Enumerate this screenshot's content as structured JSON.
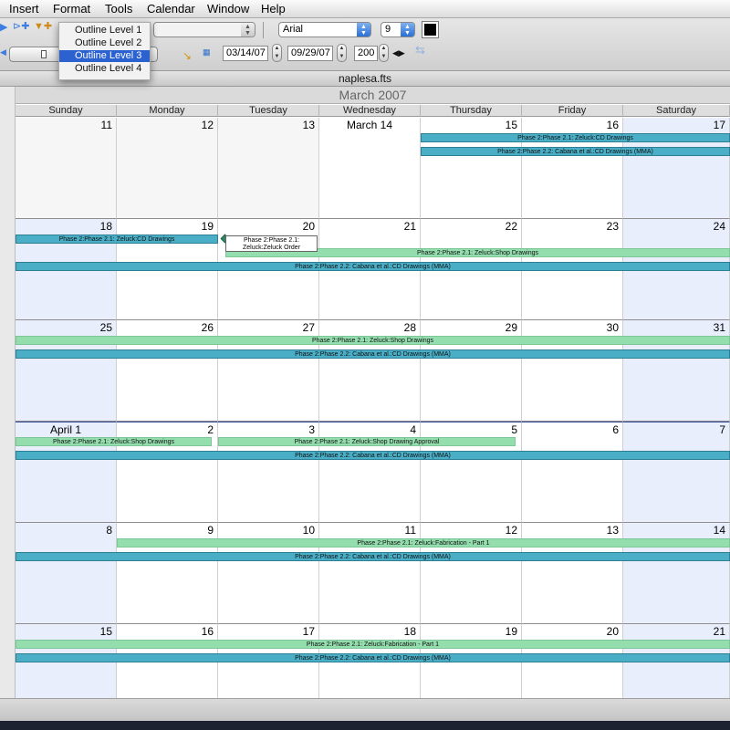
{
  "menubar": {
    "items": [
      "Insert",
      "Format",
      "Tools",
      "Calendar",
      "Window",
      "Help"
    ]
  },
  "toolbar": {
    "font": "Arial",
    "font_size": "9",
    "start_date": "03/14/07",
    "end_date": "09/29/07",
    "zoom": "200",
    "nav_arrows": "◀▶",
    "color_swatch": "#000000"
  },
  "outline_menu": {
    "items": [
      "Outline Level 1",
      "Outline Level 2",
      "Outline Level 3",
      "Outline Level 4"
    ],
    "selected_index": 2
  },
  "window": {
    "title": "naplesa.fts"
  },
  "calendar": {
    "month_title": "March 2007",
    "weekdays": [
      "Sunday",
      "Monday",
      "Tuesday",
      "Wednesday",
      "Thursday",
      "Friday",
      "Saturday"
    ],
    "weeks": [
      [
        "11",
        "12",
        "13",
        "March 14",
        "15",
        "16",
        "17"
      ],
      [
        "18",
        "19",
        "20",
        "21",
        "22",
        "23",
        "24"
      ],
      [
        "25",
        "26",
        "27",
        "28",
        "29",
        "30",
        "31"
      ],
      [
        "April 1",
        "2",
        "3",
        "4",
        "5",
        "6",
        "7"
      ],
      [
        "8",
        "9",
        "10",
        "11",
        "12",
        "13",
        "14"
      ],
      [
        "15",
        "16",
        "17",
        "18",
        "19",
        "20",
        "21"
      ]
    ],
    "tooltip": "Phase 2:Phase 2.1: Zeluck:Zeluck Order",
    "tasks": [
      {
        "week": 0,
        "start": 4,
        "end": 6,
        "lane": 0,
        "color": "teal",
        "label": "Phase 2:Phase 2.1: Zeluck:CD Drawings"
      },
      {
        "week": 0,
        "start": 4,
        "end": 6,
        "lane": 1,
        "color": "teal",
        "label": "Phase 2:Phase 2.2: Cabana et al.:CD Drawings (MMA)"
      },
      {
        "week": 1,
        "start": 0,
        "end": 1,
        "lane": 0,
        "color": "teal",
        "label": "Phase 2:Phase 2.1: Zeluck:CD Drawings"
      },
      {
        "week": 1,
        "start": 2,
        "end": 6,
        "lane": 1,
        "color": "green",
        "label": "Phase 2:Phase 2.1: Zeluck:Shop Drawings"
      },
      {
        "week": 1,
        "start": 0,
        "end": 6,
        "lane": 2,
        "color": "teal",
        "label": "Phase 2:Phase 2.2: Cabana et al.:CD Drawings (MMA)"
      },
      {
        "week": 2,
        "start": 0,
        "end": 6,
        "lane": 0,
        "color": "green",
        "label": "Phase 2:Phase 2.1: Zeluck:Shop Drawings"
      },
      {
        "week": 2,
        "start": 0,
        "end": 6,
        "lane": 1,
        "color": "teal",
        "label": "Phase 2:Phase 2.2: Cabana et al.:CD Drawings (MMA)"
      },
      {
        "week": 3,
        "start": 0,
        "end": 1,
        "lane": 0,
        "color": "green",
        "label": "Phase 2:Phase 2.1: Zeluck:Shop Drawings"
      },
      {
        "week": 3,
        "start": 2,
        "end": 4,
        "lane": 0,
        "color": "green",
        "label": "Phase 2:Phase 2.1: Zeluck:Shop Drawing Approval"
      },
      {
        "week": 3,
        "start": 0,
        "end": 6,
        "lane": 1,
        "color": "teal",
        "label": "Phase 2:Phase 2.2: Cabana et al.:CD Drawings (MMA)"
      },
      {
        "week": 4,
        "start": 1,
        "end": 6,
        "lane": 0,
        "color": "green",
        "label": "Phase 2:Phase 2.1: Zeluck:Fabrication - Part 1"
      },
      {
        "week": 4,
        "start": 0,
        "end": 6,
        "lane": 1,
        "color": "teal",
        "label": "Phase 2:Phase 2.2: Cabana et al.:CD Drawings (MMA)"
      },
      {
        "week": 5,
        "start": 0,
        "end": 6,
        "lane": 0,
        "color": "green",
        "label": "Phase 2:Phase 2.1: Zeluck:Fabrication - Part 1"
      },
      {
        "week": 5,
        "start": 0,
        "end": 6,
        "lane": 1,
        "color": "teal",
        "label": "Phase 2:Phase 2.2: Cabana et al.:CD Drawings (MMA)"
      }
    ]
  },
  "icons": [
    "add-task-icon",
    "filter-icon",
    "bar-style-icon",
    "show-today-icon",
    "view-mode-icon",
    "move-arrows-icon"
  ]
}
